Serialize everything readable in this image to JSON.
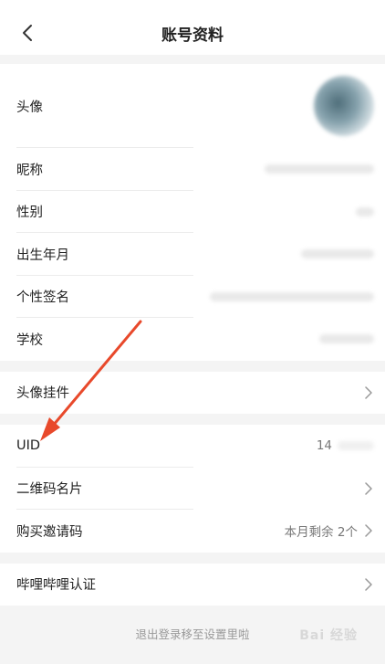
{
  "header": {
    "title": "账号资料"
  },
  "profile": {
    "avatar_label": "头像",
    "nickname_label": "昵称",
    "gender_label": "性别",
    "birth_label": "出生年月",
    "signature_label": "个性签名",
    "school_label": "学校"
  },
  "pendant": {
    "label": "头像挂件"
  },
  "account": {
    "uid_label": "UID",
    "uid_value": "14",
    "qrcode_label": "二维码名片",
    "invite_label": "购买邀请码",
    "invite_value": "本月剩余 2个"
  },
  "certify": {
    "label": "哔哩哔哩认证"
  },
  "footer": {
    "logout_hint": "退出登录移至设置里啦",
    "watermark": "Bai 经验"
  },
  "colors": {
    "annotation_arrow": "#e8492b",
    "background": "#f4f4f4"
  }
}
